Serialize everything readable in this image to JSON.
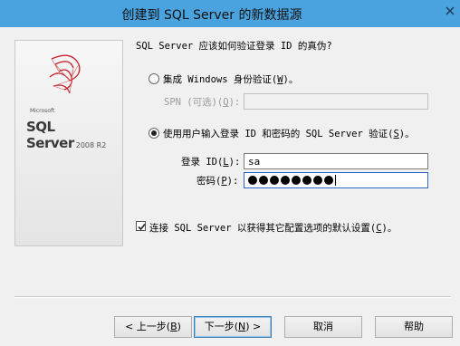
{
  "window": {
    "title": "创建到 SQL Server 的新数据源",
    "close_icon": "close-icon"
  },
  "brand": {
    "microsoft": "Microsoft",
    "product": "SQL Server",
    "version": "2008 R2"
  },
  "auth": {
    "question": "SQL Server 应该如何验证登录 ID 的真伪?",
    "windows_option": {
      "label_prefix": "集成 Windows 身份验证(",
      "hotkey": "W",
      "label_suffix": ")。",
      "selected": false
    },
    "spn": {
      "label_prefix": "SPN (可选)(",
      "hotkey": "Q",
      "label_suffix": "):",
      "value": ""
    },
    "sql_option": {
      "label_prefix": "使用用户输入登录 ID 和密码的 SQL Server 验证(",
      "hotkey": "S",
      "label_suffix": ")。",
      "selected": true
    },
    "login": {
      "label_prefix": "登录 ID(",
      "hotkey": "L",
      "label_suffix": "):",
      "value": "sa"
    },
    "password": {
      "label_prefix": "密码(",
      "hotkey": "P",
      "label_suffix": "):",
      "masked_length": 8
    }
  },
  "connect": {
    "label_prefix": "连接 SQL Server 以获得其它配置选项的默认设置(",
    "hotkey": "C",
    "label_suffix": ")。",
    "checked": true
  },
  "buttons": {
    "back": {
      "prefix": "< 上一步(",
      "hotkey": "B",
      "suffix": ")"
    },
    "next": {
      "prefix": "下一步(",
      "hotkey": "N",
      "suffix": ") >"
    },
    "cancel": "取消",
    "help": "帮助"
  }
}
